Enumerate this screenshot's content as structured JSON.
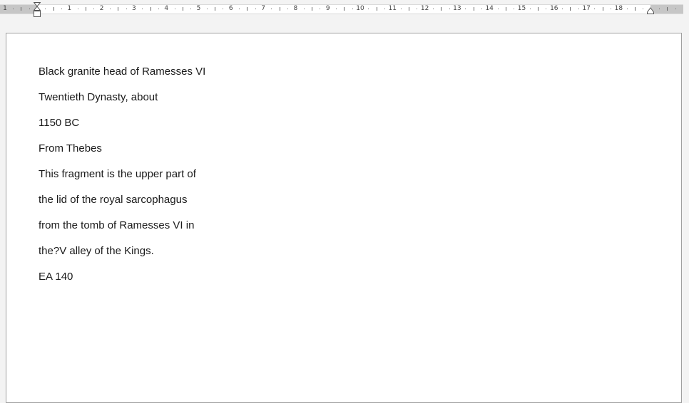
{
  "ruler": {
    "unit": "cm",
    "left_labels": [
      "1"
    ],
    "labels": [
      "1",
      "2",
      "3",
      "4",
      "5",
      "6",
      "7",
      "8",
      "9",
      "10",
      "11",
      "12",
      "13",
      "14",
      "15",
      "16",
      "17",
      "18"
    ]
  },
  "document": {
    "paragraphs": [
      "Black granite head of Ramesses VI",
      "Twentieth Dynasty, about",
      "1150 BC",
      "From Thebes",
      "This fragment is the upper part of",
      "the lid of the royal sarcophagus",
      "from the tomb of Ramesses VI in",
      "the?V alley of the Kings.",
      "EA 140"
    ]
  }
}
